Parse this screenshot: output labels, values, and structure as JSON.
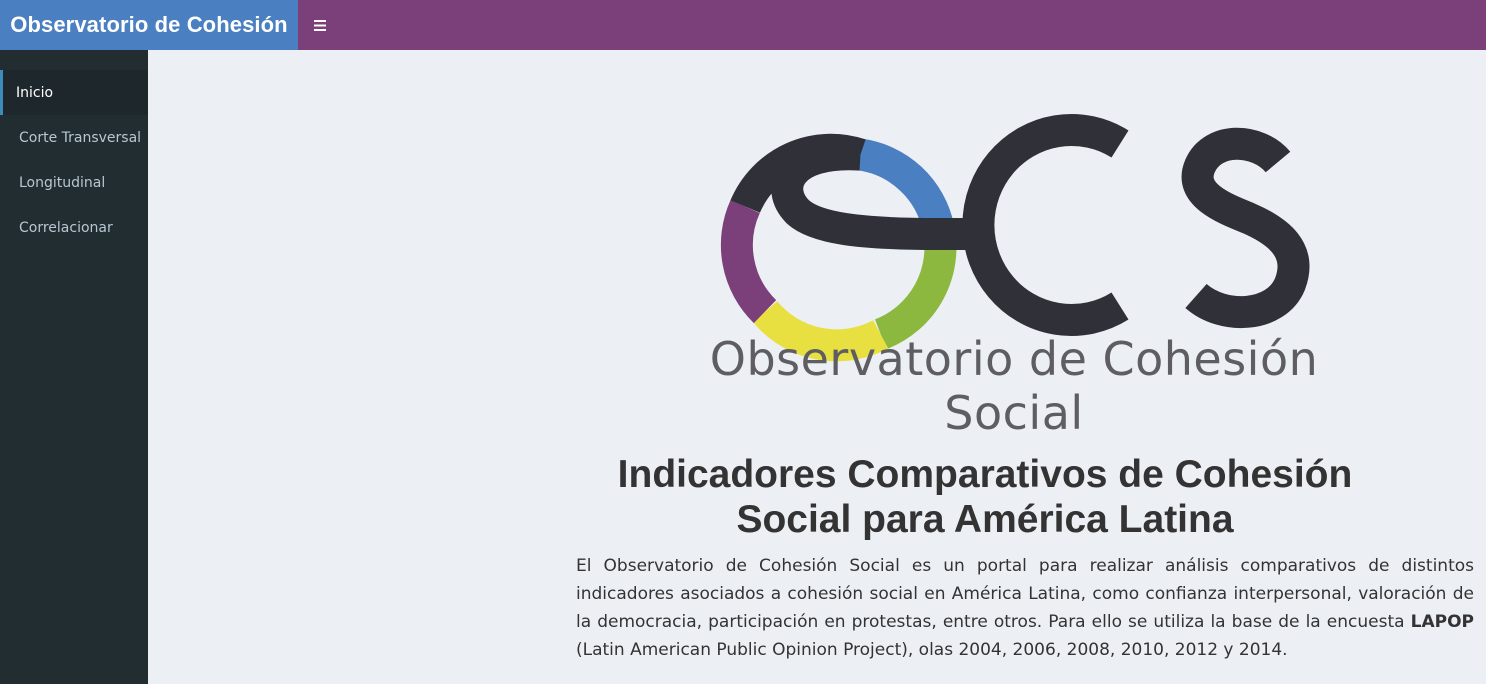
{
  "header": {
    "brand": "Observatorio de Cohesión",
    "toggle_icon": "hamburger-menu-icon",
    "colors": {
      "brand": "#4a7fc1",
      "topbar": "#7b3f7a"
    }
  },
  "sidebar": {
    "items": [
      {
        "label": "Inicio",
        "active": true
      },
      {
        "label": "Corte Transversal"
      },
      {
        "label": "Longitudinal"
      },
      {
        "label": "Correlacionar"
      }
    ]
  },
  "logo": {
    "text": "Observatorio de Cohesión Social",
    "ring_colors": [
      "#4a7fc1",
      "#8cb840",
      "#e8e040",
      "#7b3f7a"
    ],
    "mark_color": "#2f3038"
  },
  "main": {
    "title": "Indicadores Comparativos de Cohesión Social para América Latina",
    "description_part1": "El Observatorio de Cohesión Social es un portal para realizar análisis comparativos de distintos indicadores asociados a cohesión social en América Latina, como confianza interpersonal, valoración de la democracia, participación en protestas, entre otros. Para ello se utiliza la base de la encuesta ",
    "description_bold": "LAPOP",
    "description_part2": " (Latin American Public Opinion Project), olas 2004, 2006, 2008, 2010, 2012 y 2014."
  }
}
